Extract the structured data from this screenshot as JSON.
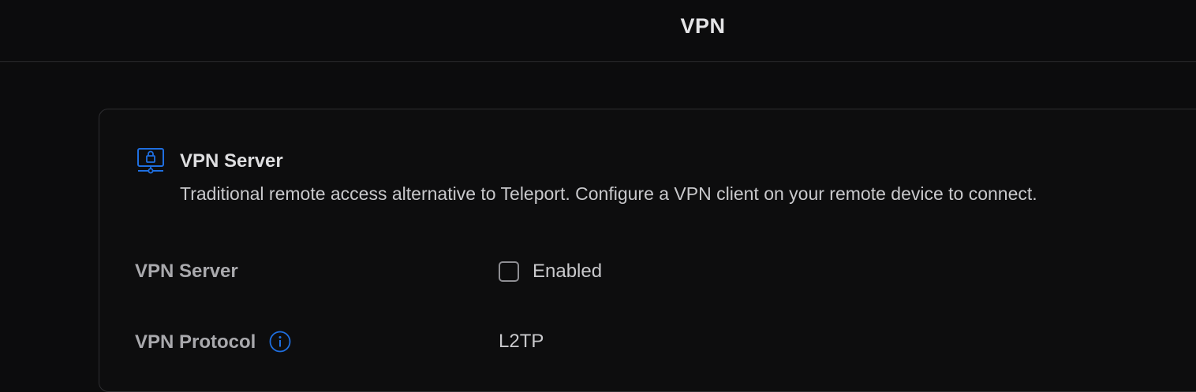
{
  "header": {
    "title": "VPN"
  },
  "vpn_server_card": {
    "icon": "vpn-lock-monitor-icon",
    "title": "VPN Server",
    "description": "Traditional remote access alternative to Teleport. Configure a VPN client on your remote device to connect."
  },
  "settings": {
    "vpn_server": {
      "label": "VPN Server",
      "checkbox_label": "Enabled",
      "checked": false
    },
    "vpn_protocol": {
      "label": "VPN Protocol",
      "info_icon": "info-icon",
      "value": "L2TP"
    }
  },
  "colors": {
    "background": "#0c0c0d",
    "accent": "#1f6fe0",
    "border": "#2e2e31"
  }
}
